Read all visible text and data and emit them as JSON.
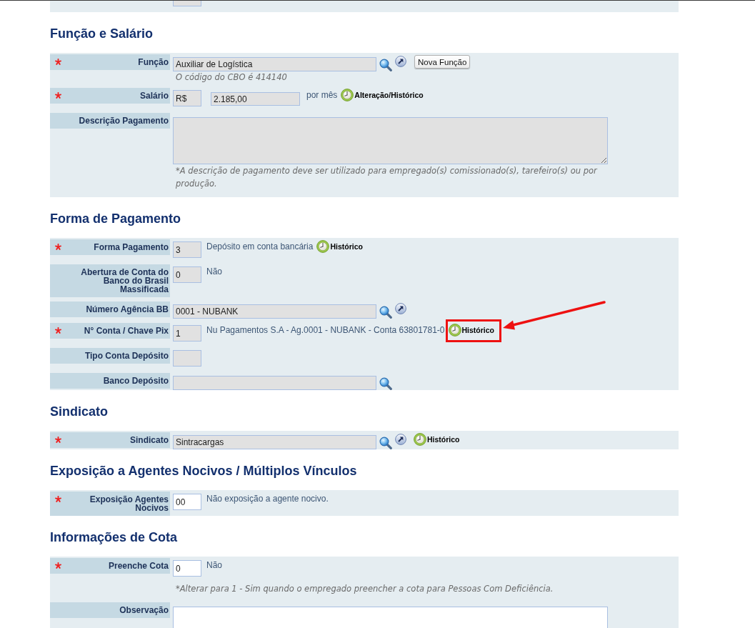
{
  "clipped_panel": {
    "fields": [
      {
        "kind": "code_input",
        "disabled": true
      }
    ]
  },
  "sections": [
    {
      "title": "Função e Salário",
      "rows": [
        {
          "label": "Função",
          "required": true,
          "items": [
            {
              "kind": "long_input",
              "value": "Auxiliar de Logística",
              "disabled": true
            },
            {
              "kind": "search_icon"
            },
            {
              "kind": "open_icon"
            },
            {
              "kind": "button",
              "label": "Nova Função"
            }
          ],
          "hint": "O código do CBO é 414140"
        },
        {
          "label": "Salário",
          "required": true,
          "items": [
            {
              "kind": "code_input",
              "value": "R$",
              "disabled": true
            },
            {
              "kind": "amount_input",
              "value": "2.185,00",
              "disabled": true
            },
            {
              "kind": "text",
              "text": "por mês"
            },
            {
              "kind": "history",
              "label": "Alteração/Histórico",
              "highlighted": false
            }
          ]
        },
        {
          "label": "Descrição Pagamento",
          "required": false,
          "items": [
            {
              "kind": "textarea",
              "disabled": true
            }
          ],
          "hint": "*A descrição de pagamento deve ser utilizado para empregado(s) comissionado(s), tarefeiro(s) ou por produção."
        }
      ]
    },
    {
      "title": "Forma de Pagamento",
      "rows": [
        {
          "label": "Forma Pagamento",
          "required": true,
          "items": [
            {
              "kind": "code_input",
              "value": "3",
              "disabled": true
            },
            {
              "kind": "text",
              "text": "Depósito em conta bancária"
            },
            {
              "kind": "history",
              "label": "Histórico",
              "highlighted": false
            }
          ]
        },
        {
          "label": "Abertura de Conta do Banco do Brasil Massificada",
          "required": false,
          "items": [
            {
              "kind": "code_input",
              "value": "0",
              "disabled": true
            },
            {
              "kind": "text",
              "text": "Não"
            }
          ]
        },
        {
          "label": "Número Agência BB",
          "required": false,
          "items": [
            {
              "kind": "long_input",
              "value": "0001 - NUBANK",
              "disabled": true
            },
            {
              "kind": "search_icon"
            },
            {
              "kind": "open_icon"
            }
          ]
        },
        {
          "label": "N° Conta / Chave Pix",
          "required": true,
          "items": [
            {
              "kind": "code_input",
              "value": "1",
              "disabled": true
            },
            {
              "kind": "text",
              "text": "Nu Pagamentos S.A - Ag.0001 - NUBANK - Conta 63801781-0"
            },
            {
              "kind": "history",
              "label": "Histórico",
              "highlighted": true
            }
          ]
        },
        {
          "label": "Tipo Conta Depósito",
          "required": false,
          "items": [
            {
              "kind": "code_input",
              "disabled": true
            }
          ]
        },
        {
          "label": "Banco Depósito",
          "required": false,
          "items": [
            {
              "kind": "long_input",
              "disabled": true
            },
            {
              "kind": "search_icon"
            }
          ]
        }
      ]
    },
    {
      "title": "Sindicato",
      "rows": [
        {
          "label": "Sindicato",
          "required": true,
          "items": [
            {
              "kind": "long_input",
              "value": "Sintracargas",
              "disabled": true
            },
            {
              "kind": "search_icon"
            },
            {
              "kind": "open_icon"
            },
            {
              "kind": "history",
              "label": "Histórico",
              "highlighted": false
            }
          ]
        }
      ]
    },
    {
      "title": "Exposição a Agentes Nocivos / Múltiplos Vínculos",
      "rows": [
        {
          "label": "Exposição Agentes Nocivos",
          "required": true,
          "items": [
            {
              "kind": "code_input",
              "value": "00",
              "disabled": false
            },
            {
              "kind": "text",
              "text": "Não exposição a agente nocivo."
            }
          ]
        }
      ]
    },
    {
      "title": "Informações de Cota",
      "rows": [
        {
          "label": "Preenche Cota",
          "required": true,
          "items": [
            {
              "kind": "code_input",
              "value": "0",
              "disabled": false
            },
            {
              "kind": "text",
              "text": "Não"
            }
          ],
          "hint": "*Alterar para 1 - Sim quando o empregado preencher a cota para Pessoas Com Deficiência."
        },
        {
          "label": "Observação",
          "required": false,
          "items": [
            {
              "kind": "textarea",
              "disabled": false
            }
          ]
        }
      ]
    }
  ]
}
